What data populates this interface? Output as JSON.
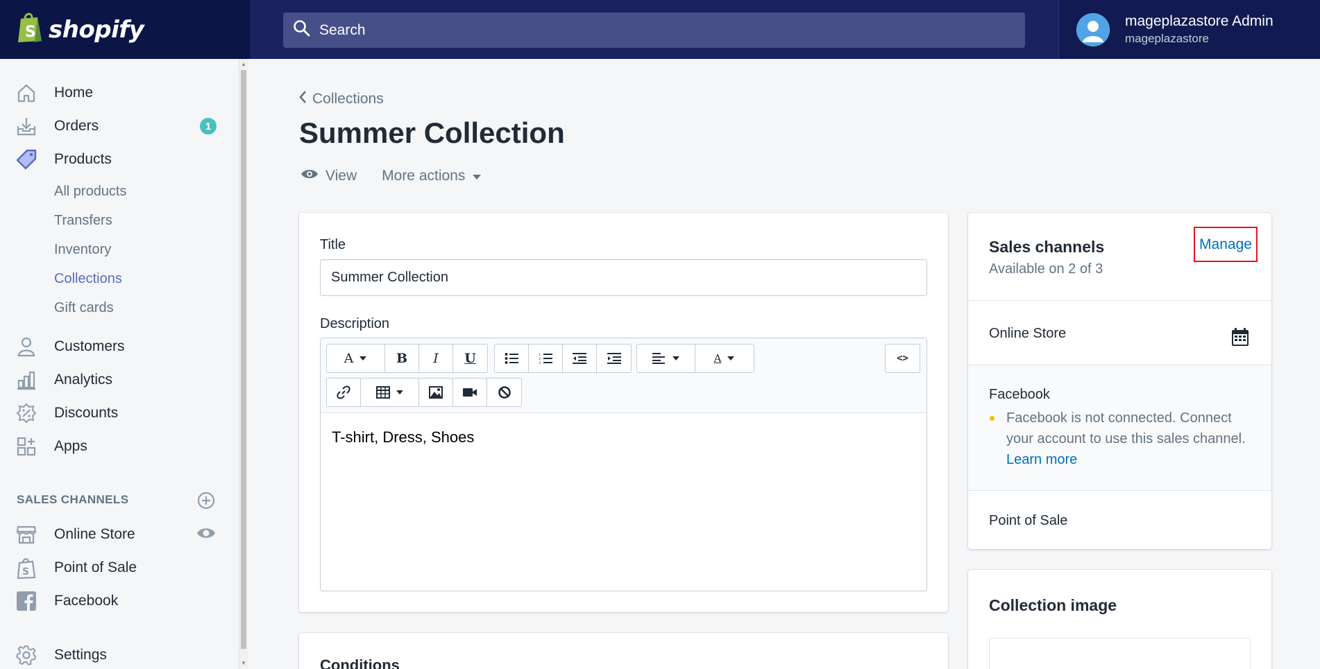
{
  "brand": {
    "name": "shopify"
  },
  "search": {
    "placeholder": "Search"
  },
  "user": {
    "name": "mageplazastore Admin",
    "store": "mageplazastore"
  },
  "sidebar": {
    "items": [
      {
        "label": "Home",
        "icon": "home-icon"
      },
      {
        "label": "Orders",
        "icon": "orders-icon",
        "badge": "1"
      },
      {
        "label": "Products",
        "icon": "tag-icon"
      }
    ],
    "product_sub": [
      "All products",
      "Transfers",
      "Inventory",
      "Collections",
      "Gift cards"
    ],
    "items2": [
      {
        "label": "Customers",
        "icon": "person-icon"
      },
      {
        "label": "Analytics",
        "icon": "bar-chart-icon"
      },
      {
        "label": "Discounts",
        "icon": "discount-icon"
      },
      {
        "label": "Apps",
        "icon": "apps-icon"
      }
    ],
    "sales_channels_heading": "SALES CHANNELS",
    "channels": [
      {
        "label": "Online Store",
        "icon": "store-icon"
      },
      {
        "label": "Point of Sale",
        "icon": "pos-icon"
      },
      {
        "label": "Facebook",
        "icon": "facebook-icon"
      }
    ],
    "settings": {
      "label": "Settings",
      "icon": "gear-icon"
    }
  },
  "page": {
    "breadcrumb": "Collections",
    "title": "Summer Collection",
    "actions": {
      "view": "View",
      "more": "More actions"
    }
  },
  "form": {
    "title_label": "Title",
    "title_value": "Summer Collection",
    "description_label": "Description",
    "description_value": "T-shirt, Dress, Shoes",
    "conditions_heading": "Conditions"
  },
  "sales_channels": {
    "heading": "Sales channels",
    "availability": "Available on 2 of 3",
    "manage": "Manage",
    "online_store": "Online Store",
    "facebook": "Facebook",
    "facebook_note": "Facebook is not connected. Connect your account to use this sales channel.",
    "learn_more": "Learn more",
    "pos": "Point of Sale"
  },
  "collection_image": {
    "heading": "Collection image"
  },
  "colors": {
    "topbar": "#1c2260",
    "brand_bg": "#0b1546",
    "accent": "#5c6ac4",
    "badge": "#47c1bf",
    "link": "#006fbb",
    "highlight": "#e8141e"
  }
}
